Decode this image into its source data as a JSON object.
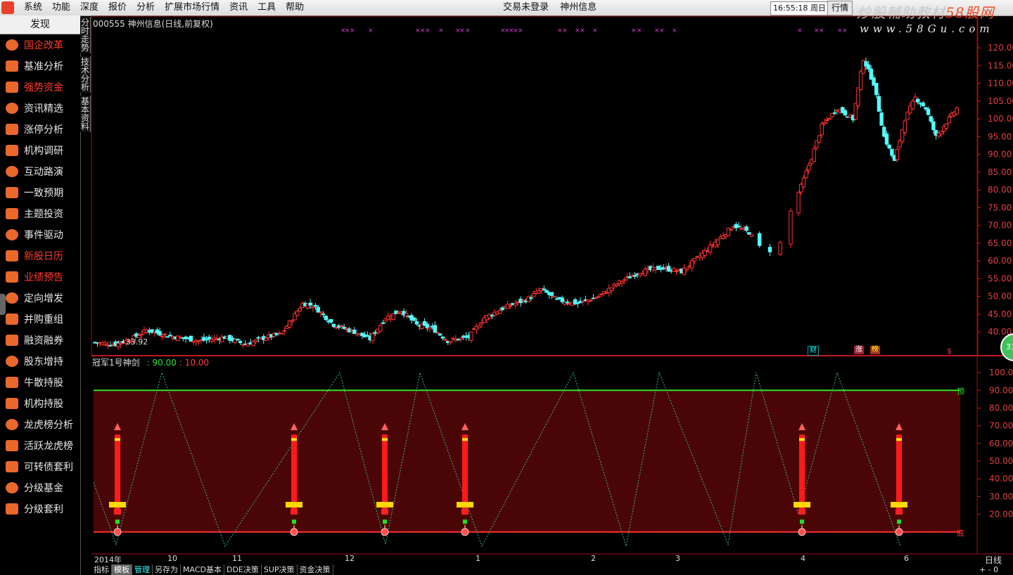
{
  "menu": [
    "系统",
    "功能",
    "深度",
    "报价",
    "分析",
    "扩展市场行情",
    "资讯",
    "工具",
    "帮助"
  ],
  "status": {
    "login": "交易未登录",
    "stock": "神州信息"
  },
  "clock": {
    "time": "16:55:18",
    "weekday": "周日"
  },
  "quote_button": "行情",
  "brand": {
    "name_gray": "炒股輔助教材",
    "name_red": "58股网",
    "url": "www.58Gu.com"
  },
  "sidebar": {
    "title": "发现",
    "items": [
      {
        "label": "国企改革",
        "active": true
      },
      {
        "label": "基准分析",
        "active": false
      },
      {
        "label": "强势资金",
        "active": true
      },
      {
        "label": "资讯精选",
        "active": false
      },
      {
        "label": "涨停分析",
        "active": false
      },
      {
        "label": "机构调研",
        "active": false
      },
      {
        "label": "互动路演",
        "active": false
      },
      {
        "label": "一致预期",
        "active": false
      },
      {
        "label": "主题投资",
        "active": false
      },
      {
        "label": "事件驱动",
        "active": false
      },
      {
        "label": "新股日历",
        "active": true
      },
      {
        "label": "业绩预告",
        "active": true
      },
      {
        "label": "定向增发",
        "active": false
      },
      {
        "label": "并购重组",
        "active": false
      },
      {
        "label": "融资融券",
        "active": false
      },
      {
        "label": "股东增持",
        "active": false
      },
      {
        "label": "牛散持股",
        "active": false
      },
      {
        "label": "机构持股",
        "active": false
      },
      {
        "label": "龙虎榜分析",
        "active": false
      },
      {
        "label": "活跃龙虎榜",
        "active": false
      },
      {
        "label": "可转债套利",
        "active": false
      },
      {
        "label": "分级基金",
        "active": false
      },
      {
        "label": "分级套利",
        "active": false
      }
    ]
  },
  "vtabs": [
    "分时走势",
    "技术分析",
    "基本资料"
  ],
  "main_chart": {
    "title": "000555 神州信息(日线,前复权)",
    "low_label": "← 33.92"
  },
  "event_tags": {
    "t1": "财",
    "t2": "涨",
    "t3": "榜",
    "dollar": "$"
  },
  "badge": "31",
  "indicator": {
    "name": "冠军1号神剑",
    "value1": ": 90.00",
    "value2": ": 10.00",
    "top_label": "顶",
    "bottom_label": "底"
  },
  "x_labels": [
    "2014年",
    "10",
    "11",
    "12",
    "1",
    "2",
    "3",
    "4",
    "6"
  ],
  "period": "日线",
  "bottom_tabs": [
    "指标",
    "模板",
    "管理",
    "另存为",
    "MACD基本",
    "DDE决策",
    "SUP决策",
    "资金决策"
  ],
  "zoom": "+ - 0",
  "chart_data": [
    {
      "type": "candlestick",
      "title": "000555 神州信息(日线,前复权)",
      "y_ticks": [
        40,
        45,
        50,
        55,
        60,
        65,
        70,
        75,
        80,
        85,
        90,
        95,
        100,
        105,
        110,
        115,
        120
      ],
      "ylim": [
        34.5,
        122
      ],
      "low_annotation": 33.92,
      "x_month_labels": [
        "2014年",
        "10",
        "11",
        "12",
        "1",
        "2",
        "3",
        "4",
        "6"
      ],
      "close_path": [
        {
          "i": 0,
          "v": 37.0
        },
        {
          "i": 8,
          "v": 36.5
        },
        {
          "i": 14,
          "v": 38
        },
        {
          "i": 20,
          "v": 40.5
        },
        {
          "i": 28,
          "v": 39
        },
        {
          "i": 40,
          "v": 37.5
        },
        {
          "i": 50,
          "v": 38.5
        },
        {
          "i": 58,
          "v": 36.5
        },
        {
          "i": 66,
          "v": 38.5
        },
        {
          "i": 72,
          "v": 39.5
        },
        {
          "i": 80,
          "v": 48
        },
        {
          "i": 84,
          "v": 47.5
        },
        {
          "i": 92,
          "v": 42
        },
        {
          "i": 100,
          "v": 40
        },
        {
          "i": 106,
          "v": 38
        },
        {
          "i": 112,
          "v": 44
        },
        {
          "i": 118,
          "v": 46
        },
        {
          "i": 124,
          "v": 42
        },
        {
          "i": 130,
          "v": 41
        },
        {
          "i": 136,
          "v": 37.5
        },
        {
          "i": 144,
          "v": 38.5
        },
        {
          "i": 150,
          "v": 44
        },
        {
          "i": 158,
          "v": 47
        },
        {
          "i": 166,
          "v": 49
        },
        {
          "i": 172,
          "v": 52
        },
        {
          "i": 178,
          "v": 49
        },
        {
          "i": 186,
          "v": 48
        },
        {
          "i": 194,
          "v": 50
        },
        {
          "i": 202,
          "v": 54
        },
        {
          "i": 210,
          "v": 57
        },
        {
          "i": 218,
          "v": 58
        },
        {
          "i": 226,
          "v": 57
        },
        {
          "i": 234,
          "v": 62
        },
        {
          "i": 240,
          "v": 66
        },
        {
          "i": 246,
          "v": 70
        },
        {
          "i": 252,
          "v": 68
        },
        {
          "i": 258,
          "v": 62
        },
        {
          "i": 264,
          "v": 65
        },
        {
          "i": 268,
          "v": 74
        },
        {
          "i": 272,
          "v": 81
        },
        {
          "i": 276,
          "v": 89
        },
        {
          "i": 280,
          "v": 98
        },
        {
          "i": 286,
          "v": 103
        },
        {
          "i": 292,
          "v": 100
        },
        {
          "i": 296,
          "v": 117
        },
        {
          "i": 300,
          "v": 110
        },
        {
          "i": 304,
          "v": 95
        },
        {
          "i": 308,
          "v": 88
        },
        {
          "i": 312,
          "v": 100
        },
        {
          "i": 316,
          "v": 106
        },
        {
          "i": 320,
          "v": 103
        },
        {
          "i": 324,
          "v": 95
        },
        {
          "i": 328,
          "v": 99
        },
        {
          "i": 332,
          "v": 103
        }
      ]
    },
    {
      "type": "line",
      "title": "冠军1号神剑",
      "y_ticks": [
        20,
        30,
        40,
        50,
        60,
        70,
        80,
        90,
        100
      ],
      "ylim": [
        0,
        104
      ],
      "reference_lines": [
        {
          "value": 90,
          "label": "顶"
        },
        {
          "value": 10,
          "label": "底"
        }
      ],
      "zigzag": [
        38,
        3,
        100,
        2,
        100,
        3,
        100,
        2,
        100,
        2,
        100,
        3,
        100,
        20,
        100,
        2,
        100,
        2
      ],
      "buy_signal_count": 6
    }
  ]
}
